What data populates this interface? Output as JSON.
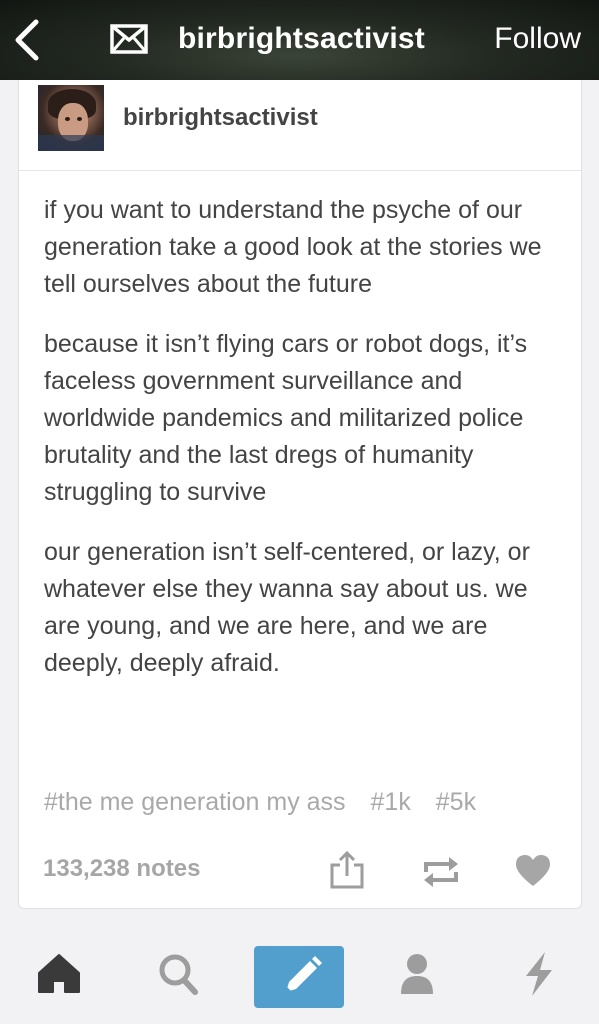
{
  "topbar": {
    "title": "birbrightsactivist",
    "follow_label": "Follow",
    "icons": [
      "back-chevron-icon",
      "mail-icon"
    ]
  },
  "post": {
    "author": "birbrightsactivist",
    "paragraphs": [
      "if you want to understand the psyche of our generation take a good look at the stories we tell ourselves about the future",
      "because it isn’t flying cars or robot dogs, it’s faceless government surveillance and worldwide pandemics and militarized police brutality and the last dregs of humanity struggling to survive",
      "our generation isn’t self-centered, or lazy, or whatever else they wanna say about us. we are young, and we are here, and we are deeply, deeply afraid."
    ],
    "tags": [
      "#the me generation my ass",
      "#1k",
      "#5k"
    ],
    "notes": "133,238 notes",
    "action_icons": [
      "share-icon",
      "reblog-icon",
      "heart-icon"
    ]
  },
  "tabbar": {
    "icons": [
      "home-icon",
      "search-icon",
      "compose-pencil-icon",
      "account-icon",
      "activity-lightning-icon"
    ],
    "active": "home-icon",
    "compose_color": "#529ecc"
  },
  "colors": {
    "topbar_bg": "#1c221b",
    "text": "#444444",
    "muted": "#a9a9a9",
    "icon_gray": "#9d9d9d",
    "icon_dark": "#3a3a3a"
  }
}
